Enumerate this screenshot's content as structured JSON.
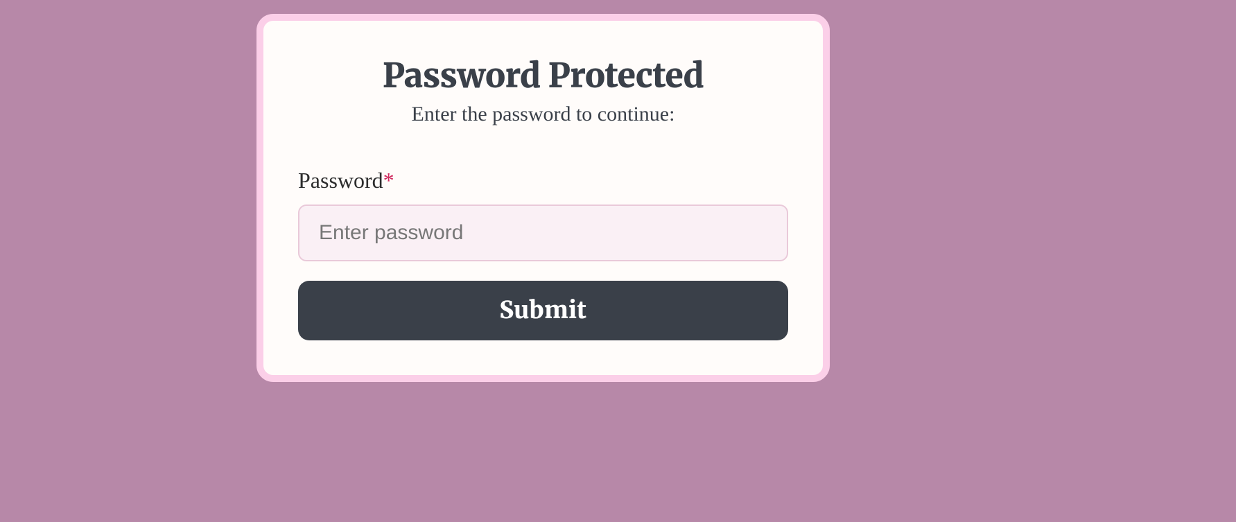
{
  "card": {
    "title": "Password Protected",
    "subtitle": "Enter the password to continue:",
    "password_label": "Password",
    "required_marker": "*",
    "password_placeholder": "Enter password",
    "password_value": "",
    "submit_label": "Submit"
  }
}
